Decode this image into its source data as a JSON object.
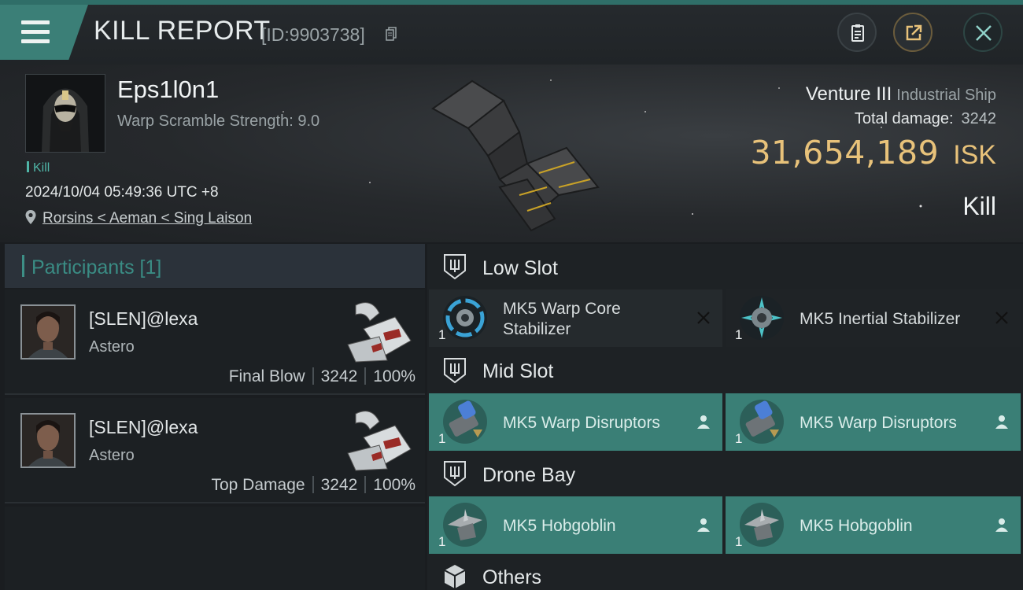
{
  "header": {
    "title": "KILL REPORT",
    "report_id": "[ID:9903738]",
    "buttons": [
      "clipboard-icon",
      "share-icon",
      "close-icon"
    ]
  },
  "victim": {
    "name": "Eps1l0n1",
    "stat": "Warp Scramble Strength: 9.0",
    "tag": "Kill",
    "timestamp": "2024/10/04 05:49:36 UTC +8",
    "location": "Rorsins < Aeman < Sing Laison"
  },
  "ship": {
    "name": "Venture III",
    "class": "Industrial Ship",
    "total_damage_label": "Total damage:",
    "total_damage": "3242",
    "isk_value": "31,654,189",
    "isk_unit": "ISK",
    "result": "Kill"
  },
  "participants": {
    "title": "Participants [1]",
    "rows": [
      {
        "name": "[SLEN]@lexa",
        "ship": "Astero",
        "role": "Final Blow",
        "damage": "3242",
        "percent": "100%"
      },
      {
        "name": "[SLEN]@lexa",
        "ship": "Astero",
        "role": "Top Damage",
        "damage": "3242",
        "percent": "100%"
      }
    ]
  },
  "slots": {
    "low": {
      "title": "Low Slot",
      "items": [
        {
          "line1": "MK5 Warp Core",
          "line2": "Stabilizer",
          "qty": "1",
          "action": "remove-icon"
        },
        {
          "line1": "MK5 Inertial Stabilizer",
          "line2": "",
          "qty": "1",
          "action": "remove-icon"
        }
      ]
    },
    "mid": {
      "title": "Mid Slot",
      "items": [
        {
          "line1": "MK5 Warp Disruptors",
          "qty": "1",
          "action": "person-icon"
        },
        {
          "line1": "MK5 Warp Disruptors",
          "qty": "1",
          "action": "person-icon"
        }
      ]
    },
    "drone": {
      "title": "Drone Bay",
      "items": [
        {
          "line1": "MK5  Hobgoblin",
          "qty": "1",
          "action": "person-icon"
        },
        {
          "line1": "MK5  Hobgoblin",
          "qty": "1",
          "action": "person-icon"
        }
      ]
    },
    "others": {
      "title": "Others"
    }
  },
  "colors": {
    "accent": "#3a7f76",
    "isk": "#e8c27a",
    "teal_text": "#3a8c84"
  }
}
